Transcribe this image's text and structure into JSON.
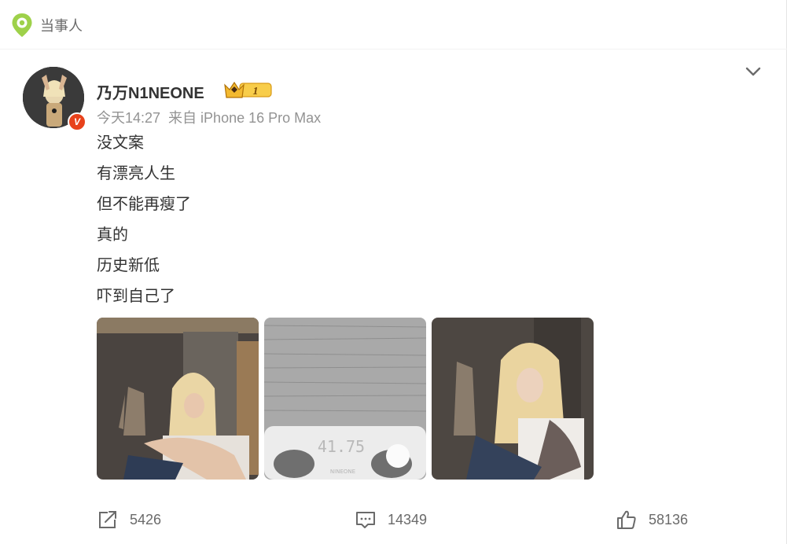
{
  "header": {
    "label": "当事人",
    "icon": "location-pin-icon"
  },
  "post": {
    "username": "乃万N1NEONE",
    "vip_level": "1",
    "verified_badge": "V",
    "time": "今天14:27",
    "source": "来自 iPhone 16 Pro Max",
    "lines": [
      "没文案",
      "有漂亮人生",
      "但不能再瘦了",
      "真的",
      "历史新低",
      "吓到自己了"
    ],
    "images": [
      {
        "name": "photo-1"
      },
      {
        "name": "photo-2",
        "scale_reading": "41.75",
        "scale_brand": "NINEONE"
      },
      {
        "name": "photo-3"
      }
    ]
  },
  "actions": {
    "repost_count": "5426",
    "comment_count": "14349",
    "like_count": "58136"
  },
  "colors": {
    "pin_green": "#9ed14a",
    "badge_red": "#e8421b",
    "crown_gold": "#f3b92f"
  }
}
